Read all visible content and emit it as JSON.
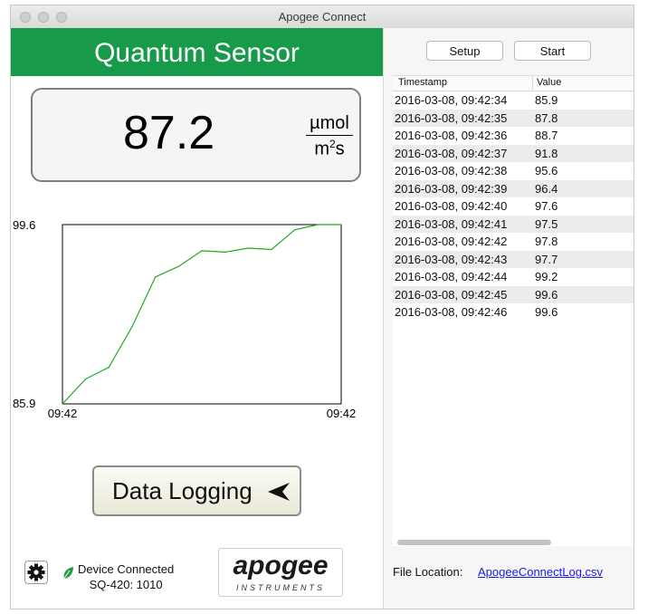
{
  "window": {
    "title": "Apogee Connect"
  },
  "header": {
    "title": "Quantum Sensor"
  },
  "reading": {
    "value": "87.2",
    "unit_top": "µmol",
    "unit_bottom": "m",
    "unit_sup": "2",
    "unit_tail": "s"
  },
  "chart_data": {
    "type": "line",
    "title": "",
    "xlabel": "",
    "ylabel": "",
    "ylim": [
      85.9,
      99.6
    ],
    "y_tick_labels": [
      "99.6",
      "85.9"
    ],
    "x_tick_labels": [
      "09:42",
      "09:42"
    ],
    "x": [
      "09:42:34",
      "09:42:35",
      "09:42:36",
      "09:42:37",
      "09:42:38",
      "09:42:39",
      "09:42:40",
      "09:42:41",
      "09:42:42",
      "09:42:43",
      "09:42:44",
      "09:42:45",
      "09:42:46"
    ],
    "values": [
      85.9,
      87.8,
      88.7,
      91.8,
      95.6,
      96.4,
      97.6,
      97.5,
      97.8,
      97.7,
      99.2,
      99.6,
      99.6
    ],
    "series_color": "#22aa22"
  },
  "logging_button": {
    "label": "Data Logging"
  },
  "device": {
    "status": "Device Connected",
    "model": "SQ-420: 1010"
  },
  "logo": {
    "word": "apogee",
    "sub": "INSTRUMENTS"
  },
  "toolbar": {
    "setup_label": "Setup",
    "start_label": "Start"
  },
  "table": {
    "columns": [
      "Timestamp",
      "Value"
    ],
    "rows": [
      {
        "ts": "2016-03-08, 09:42:34",
        "v": "85.9"
      },
      {
        "ts": "2016-03-08, 09:42:35",
        "v": "87.8"
      },
      {
        "ts": "2016-03-08, 09:42:36",
        "v": "88.7"
      },
      {
        "ts": "2016-03-08, 09:42:37",
        "v": "91.8"
      },
      {
        "ts": "2016-03-08, 09:42:38",
        "v": "95.6"
      },
      {
        "ts": "2016-03-08, 09:42:39",
        "v": "96.4"
      },
      {
        "ts": "2016-03-08, 09:42:40",
        "v": "97.6"
      },
      {
        "ts": "2016-03-08, 09:42:41",
        "v": "97.5"
      },
      {
        "ts": "2016-03-08, 09:42:42",
        "v": "97.8"
      },
      {
        "ts": "2016-03-08, 09:42:43",
        "v": "97.7"
      },
      {
        "ts": "2016-03-08, 09:42:44",
        "v": "99.2"
      },
      {
        "ts": "2016-03-08, 09:42:45",
        "v": "99.6"
      },
      {
        "ts": "2016-03-08, 09:42:46",
        "v": "99.6"
      }
    ]
  },
  "file": {
    "label": "File Location:",
    "link": "ApogeeConnectLog.csv"
  },
  "colors": {
    "header_green": "#179b4a",
    "link_blue": "#1a1ae8"
  }
}
